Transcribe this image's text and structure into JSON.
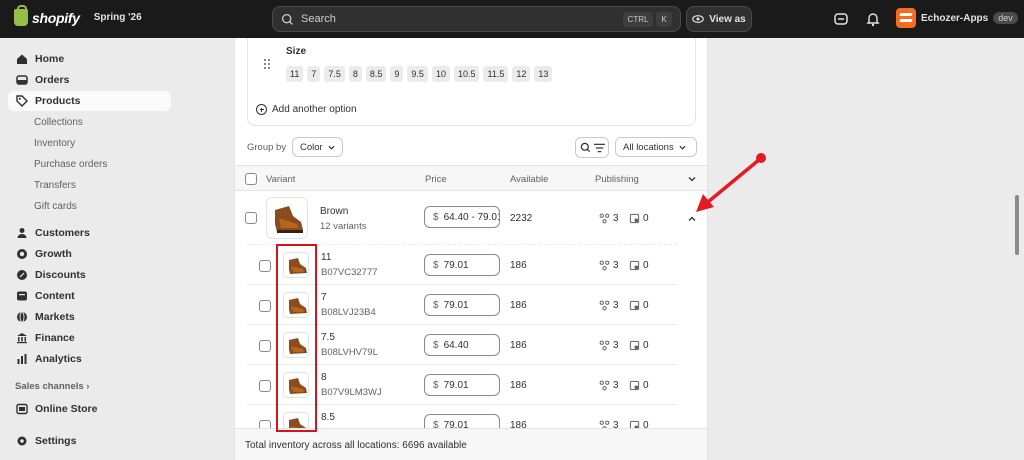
{
  "topbar": {
    "brand": "shopify",
    "release": "Spring '26",
    "search_placeholder": "Search",
    "kbd_ctrl": "CTRL",
    "kbd_k": "K",
    "view_as": "View as",
    "store_name": "Echozer-Apps",
    "store_badge": "dev"
  },
  "sidebar": {
    "items": [
      {
        "label": "Home",
        "icon": "home-icon"
      },
      {
        "label": "Orders",
        "icon": "inbox-icon"
      },
      {
        "label": "Products",
        "icon": "tag-icon"
      },
      {
        "label": "Customers",
        "icon": "person-icon"
      },
      {
        "label": "Growth",
        "icon": "target-icon"
      },
      {
        "label": "Discounts",
        "icon": "discount-icon"
      },
      {
        "label": "Content",
        "icon": "content-icon"
      },
      {
        "label": "Markets",
        "icon": "globe-icon"
      },
      {
        "label": "Finance",
        "icon": "bank-icon"
      },
      {
        "label": "Analytics",
        "icon": "chart-icon"
      }
    ],
    "product_subitems": [
      "Collections",
      "Inventory",
      "Purchase orders",
      "Transfers",
      "Gift cards"
    ],
    "sales_channels_label": "Sales channels",
    "online_store": "Online Store",
    "settings": "Settings"
  },
  "options": {
    "size_label": "Size",
    "sizes": [
      "11",
      "7",
      "7.5",
      "8",
      "8.5",
      "9",
      "9.5",
      "10",
      "10.5",
      "11.5",
      "12",
      "13"
    ],
    "add_another": "Add another option"
  },
  "toolbar": {
    "group_by_label": "Group by",
    "group_by_value": "Color",
    "locations_value": "All locations"
  },
  "table": {
    "headers": {
      "variant": "Variant",
      "price": "Price",
      "available": "Available",
      "publishing": "Publishing"
    },
    "group_row": {
      "title": "Brown",
      "subtitle": "12 variants",
      "price_symbol": "$",
      "price": "64.40 - 79.01",
      "available": "2232",
      "pub_channels": "3",
      "pub_catalogs": "0"
    },
    "rows": [
      {
        "title": "11",
        "sku": "B07VC32777",
        "price": "79.01",
        "available": "186",
        "pub_channels": "3",
        "pub_catalogs": "0"
      },
      {
        "title": "7",
        "sku": "B08LVJ23B4",
        "price": "79.01",
        "available": "186",
        "pub_channels": "3",
        "pub_catalogs": "0"
      },
      {
        "title": "7.5",
        "sku": "B08LVHV79L",
        "price": "64.40",
        "available": "186",
        "pub_channels": "3",
        "pub_catalogs": "0"
      },
      {
        "title": "8",
        "sku": "B07V9LM3WJ",
        "price": "79.01",
        "available": "186",
        "pub_channels": "3",
        "pub_catalogs": "0"
      },
      {
        "title": "8.5",
        "sku": "",
        "price": "79.01",
        "available": "186",
        "pub_channels": "3",
        "pub_catalogs": "0"
      }
    ],
    "footer": "Total inventory across all locations: 6696 available"
  },
  "annotation": {
    "highlight_color": "#d6141e",
    "arrow_color": "#e31b23"
  }
}
